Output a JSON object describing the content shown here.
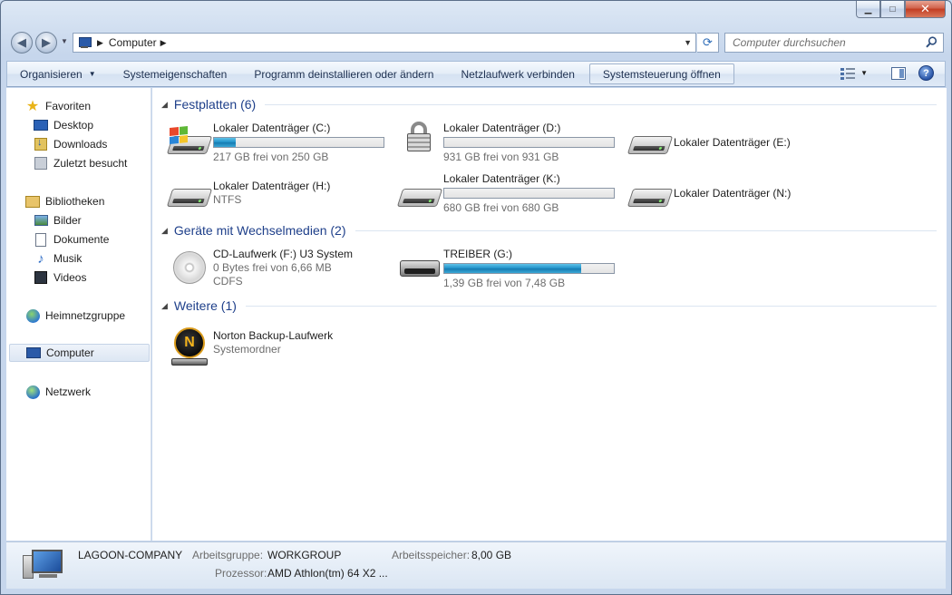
{
  "window": {
    "caption_buttons": {
      "minimize": "▁",
      "maximize": "□",
      "close": "✕"
    }
  },
  "address": {
    "back_icon": "back-arrow-icon",
    "forward_icon": "forward-arrow-icon",
    "path_item": "Computer",
    "separator": "▶",
    "search_placeholder": "Computer durchsuchen"
  },
  "toolbar": {
    "organize": "Organisieren",
    "system_properties": "Systemeigenschaften",
    "uninstall": "Programm deinstallieren oder ändern",
    "map_drive": "Netzlaufwerk verbinden",
    "control_panel": "Systemsteuerung öffnen",
    "help": "?"
  },
  "sidebar": {
    "favorites": "Favoriten",
    "desktop": "Desktop",
    "downloads": "Downloads",
    "recent": "Zuletzt besucht",
    "libraries": "Bibliotheken",
    "pictures": "Bilder",
    "documents": "Dokumente",
    "music": "Musik",
    "videos": "Videos",
    "homegroup": "Heimnetzgruppe",
    "computer": "Computer",
    "network": "Netzwerk"
  },
  "groups": {
    "hard_drives": "Festplatten (6)",
    "removable": "Geräte mit Wechselmedien (2)",
    "other": "Weitere (1)"
  },
  "drives": {
    "c": {
      "name": "Lokaler Datenträger (C:)",
      "info": "217 GB frei von 250 GB",
      "used_fraction": 0.13
    },
    "d": {
      "name": "Lokaler Datenträger (D:)",
      "info": "931 GB frei von 931 GB",
      "used_fraction": 0.0
    },
    "e": {
      "name": "Lokaler Datenträger (E:)"
    },
    "h": {
      "name": "Lokaler Datenträger (H:)",
      "info": "NTFS"
    },
    "k": {
      "name": "Lokaler Datenträger (K:)",
      "info": "680 GB frei von 680 GB",
      "used_fraction": 0.0
    },
    "n": {
      "name": "Lokaler Datenträger (N:)"
    },
    "f": {
      "name": "CD-Laufwerk (F:) U3 System",
      "info": "0 Bytes frei von 6,66 MB",
      "fs": "CDFS"
    },
    "g": {
      "name": "TREIBER (G:)",
      "info": "1,39 GB frei von 7,48 GB",
      "used_fraction": 0.81
    },
    "norton": {
      "name": "Norton Backup-Laufwerk",
      "info": "Systemordner",
      "logo": "N"
    }
  },
  "details": {
    "computer_name": "LAGOON-COMPANY",
    "workgroup_label": "Arbeitsgruppe:",
    "workgroup": "WORKGROUP",
    "memory_label": "Arbeitsspeicher:",
    "memory": "8,00 GB",
    "cpu_label": "Prozessor:",
    "cpu": "AMD Athlon(tm) 64 X2 ..."
  }
}
